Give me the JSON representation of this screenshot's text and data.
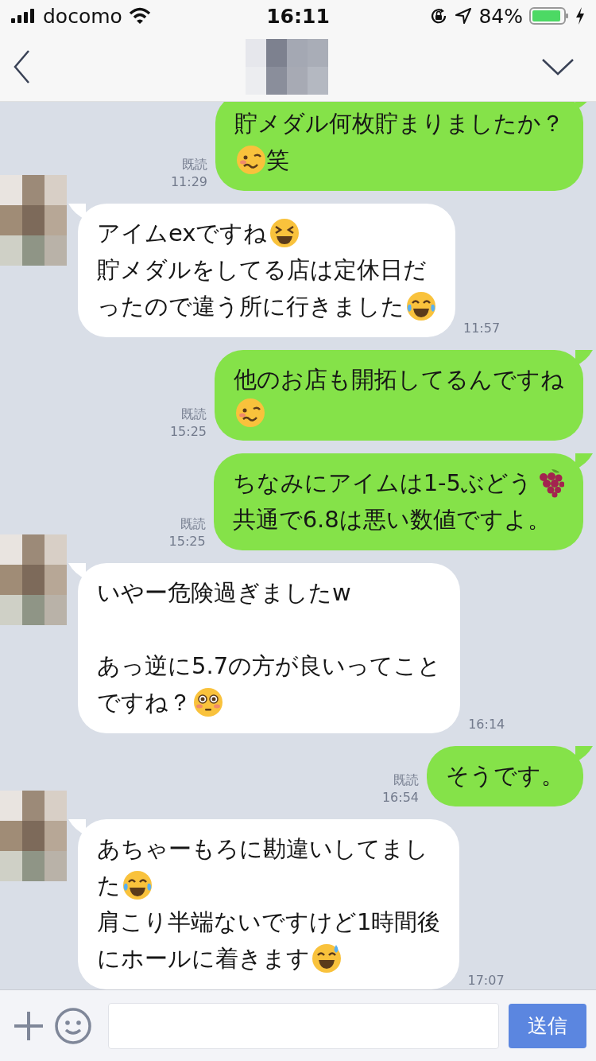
{
  "status_bar": {
    "carrier": "docomo",
    "time": "16:11",
    "battery": "84%"
  },
  "input_bar": {
    "send_button": "送信"
  },
  "messages": [
    {
      "kind": "sent",
      "read": "既読",
      "time": "11:29",
      "paragraphs": [
        [
          [
            {
              "kind": "text",
              "text": "貯メダル何枚貯まりましたか？"
            }
          ],
          [
            {
              "kind": "woozy"
            },
            {
              "kind": "text",
              "text": "笑"
            }
          ]
        ]
      ]
    },
    {
      "kind": "received",
      "time": "11:57",
      "paragraphs": [
        [
          [
            {
              "kind": "text",
              "text": "アイムexですね"
            },
            {
              "kind": "laughing"
            }
          ],
          [
            {
              "kind": "text",
              "text": "貯メダルをしてる店は定休日だ"
            }
          ],
          [
            {
              "kind": "text",
              "text": "ったので違う所に行きました"
            },
            {
              "kind": "tears"
            }
          ]
        ]
      ]
    },
    {
      "kind": "sent",
      "read": "既読",
      "time": "15:25",
      "paragraphs": [
        [
          [
            {
              "kind": "text",
              "text": "他のお店も開拓してるんですね"
            }
          ],
          [
            {
              "kind": "woozy"
            }
          ]
        ]
      ]
    },
    {
      "kind": "sent",
      "read": "既読",
      "time": "15:25",
      "paragraphs": [
        [
          [
            {
              "kind": "text",
              "text": "ちなみにアイムは1-5ぶどう"
            },
            {
              "kind": "grapes"
            }
          ],
          [
            {
              "kind": "text",
              "text": "共通で6.8は悪い数値ですよ。"
            }
          ]
        ]
      ]
    },
    {
      "kind": "received",
      "time": "16:14",
      "paragraphs": [
        [
          [
            {
              "kind": "text",
              "text": "いやー危険過ぎましたw"
            }
          ]
        ],
        [
          [
            {
              "kind": "text",
              "text": "あっ逆に5.7の方が良いってこと"
            }
          ],
          [
            {
              "kind": "text",
              "text": "ですね？"
            },
            {
              "kind": "flushed"
            }
          ]
        ]
      ]
    },
    {
      "kind": "sent",
      "read": "既読",
      "time": "16:54",
      "paragraphs": [
        [
          [
            {
              "kind": "text",
              "text": "そうです。"
            }
          ]
        ]
      ]
    },
    {
      "kind": "received",
      "time": "17:07",
      "paragraphs": [
        [
          [
            {
              "kind": "text",
              "text": "あちゃーもろに勘違いしてまし"
            }
          ],
          [
            {
              "kind": "text",
              "text": "た"
            },
            {
              "kind": "tears"
            }
          ],
          [
            {
              "kind": "text",
              "text": "肩こり半端ないですけど1時間後"
            }
          ],
          [
            {
              "kind": "text",
              "text": "にホールに着きます"
            },
            {
              "kind": "sweat"
            }
          ]
        ]
      ]
    }
  ]
}
